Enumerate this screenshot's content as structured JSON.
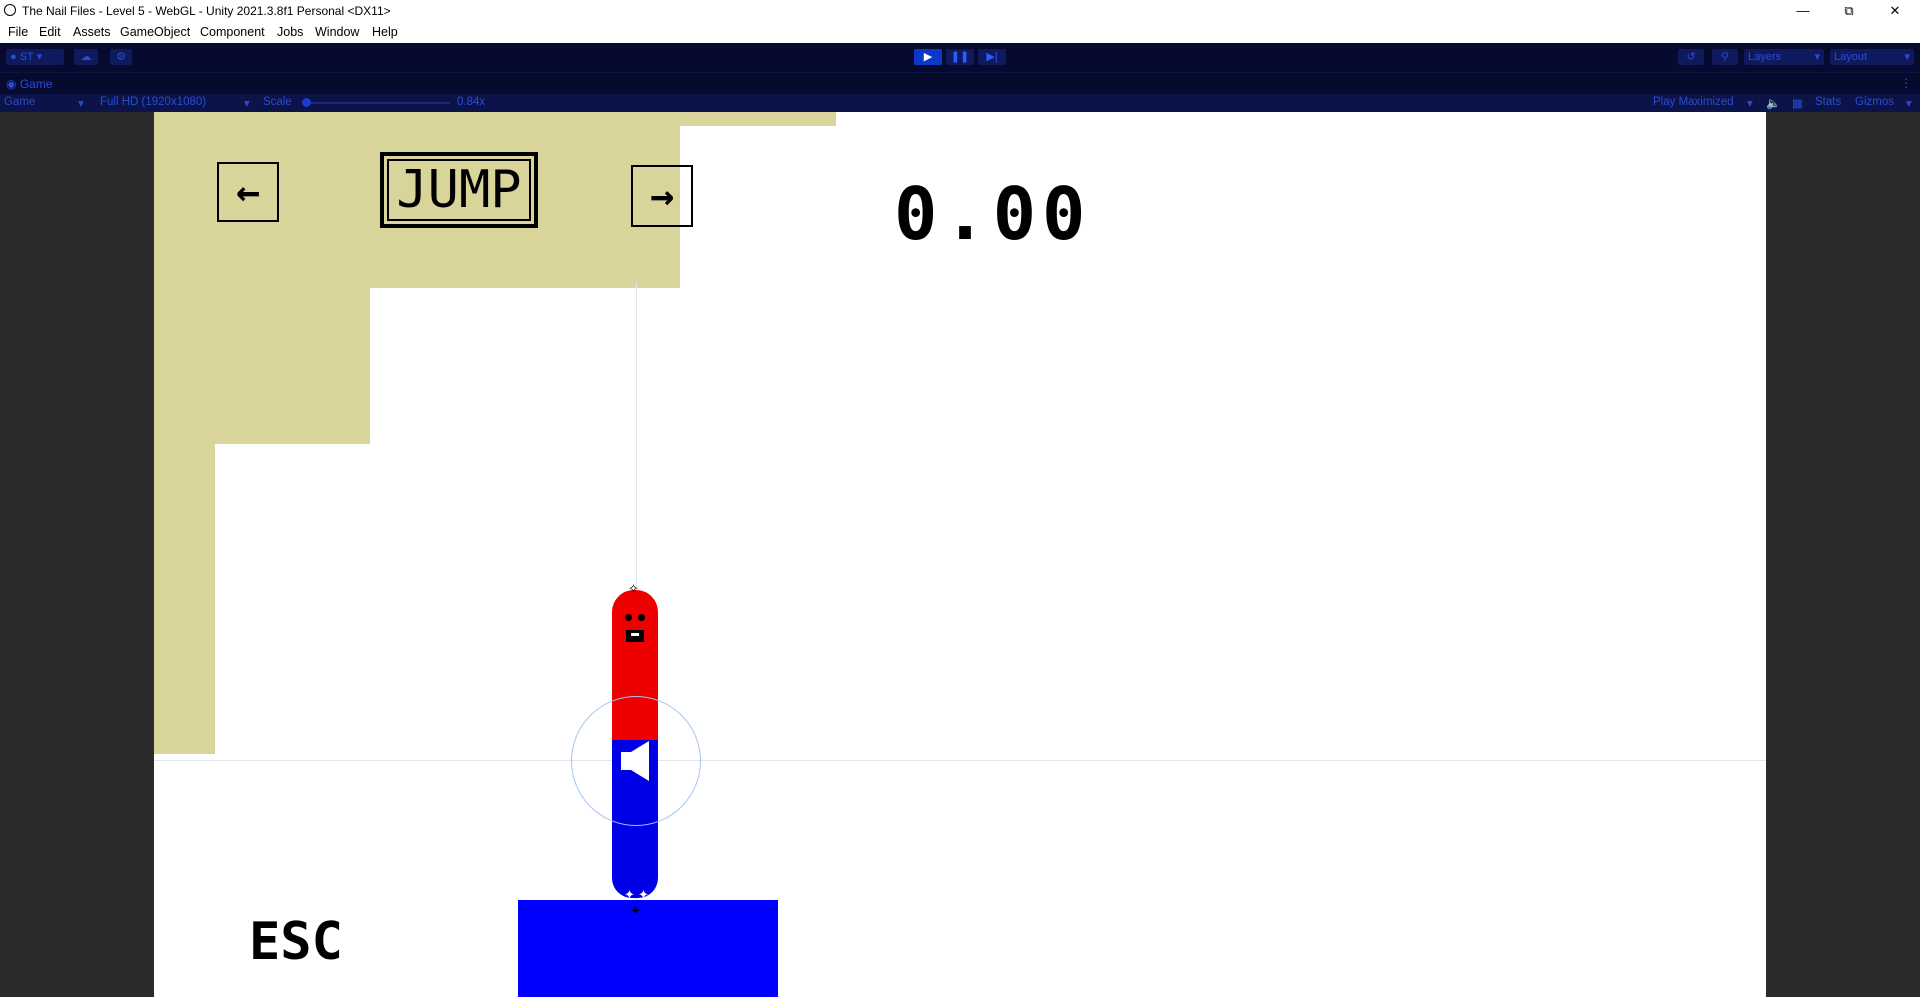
{
  "window": {
    "title": "The Nail Files - Level 5 - WebGL - Unity 2021.3.8f1 Personal <DX11>",
    "minimize_icon": "minimize-icon",
    "restore_icon": "restore-icon",
    "close_icon": "close-icon"
  },
  "menu": [
    "File",
    "Edit",
    "Assets",
    "GameObject",
    "Component",
    "Jobs",
    "Window",
    "Help"
  ],
  "toolbar": {
    "account_label": "ST",
    "layers_label": "Layers",
    "layout_label": "Layout",
    "accent_color": "#0a38c8"
  },
  "game_tab": {
    "label": "Game"
  },
  "game_bar": {
    "display_label": "Game",
    "resolution_label": "Full HD (1920x1080)",
    "scale_label": "Scale",
    "scale_value": "0.84x",
    "play_mode_label": "Play Maximized",
    "stats_label": "Stats",
    "gizmos_label": "Gizmos"
  },
  "game": {
    "left_button_glyph": "←",
    "jump_label": "JUMP",
    "right_button_glyph": "→",
    "timer": "0.00",
    "esc_label": "ESC",
    "colors": {
      "sand": "#d9d59a",
      "worm_top": "#ee0000",
      "worm_bottom": "#0000e6",
      "platform": "#0000ff"
    }
  }
}
